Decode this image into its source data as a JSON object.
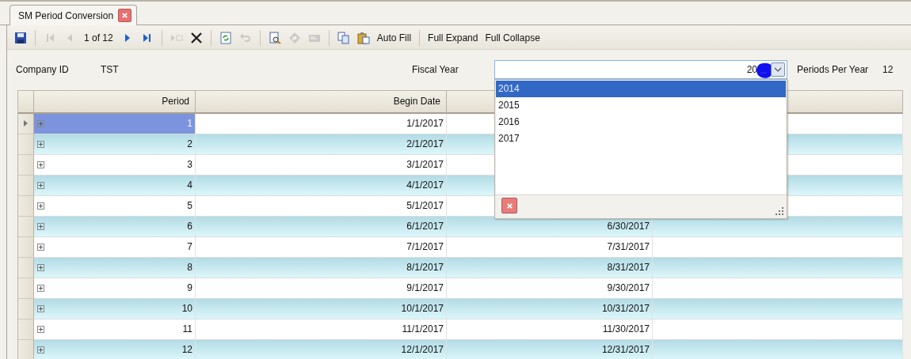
{
  "tabs": [
    {
      "title": "SM Period Conversion",
      "selected": true
    }
  ],
  "toolbar": {
    "groups": [
      [
        {
          "kind": "save",
          "disabled": false
        }
      ],
      [
        {
          "kind": "first",
          "disabled": true
        },
        {
          "kind": "prev",
          "disabled": true
        },
        {
          "kind": "counter",
          "text": "1 of 12"
        },
        {
          "kind": "next",
          "disabled": false
        },
        {
          "kind": "last",
          "disabled": false
        }
      ],
      [
        {
          "kind": "append",
          "disabled": true
        },
        {
          "kind": "delete",
          "disabled": false
        }
      ],
      [
        {
          "kind": "refresh",
          "disabled": false
        },
        {
          "kind": "undo",
          "disabled": true
        }
      ],
      [
        {
          "kind": "preview",
          "disabled": false
        },
        {
          "kind": "forward",
          "disabled": true
        },
        {
          "kind": "mail",
          "disabled": true
        }
      ],
      [
        {
          "kind": "copy",
          "disabled": false
        },
        {
          "kind": "paste",
          "disabled": false
        },
        {
          "kind": "text",
          "text": "Auto Fill"
        }
      ],
      [
        {
          "kind": "text",
          "text": "Full Expand"
        },
        {
          "kind": "text",
          "text": "Full Collapse"
        }
      ]
    ]
  },
  "form": {
    "company_label": "Company ID",
    "company_value": "TST",
    "fiscal_year_label": "Fiscal Year",
    "fiscal_year_value": "20",
    "periods_label": "Periods Per Year",
    "periods_value": "12"
  },
  "fiscal_year_dropdown": {
    "expanded": true,
    "options": [
      {
        "label": "2014",
        "selected": true
      },
      {
        "label": "2015",
        "selected": false
      },
      {
        "label": "2016",
        "selected": false
      },
      {
        "label": "2017",
        "selected": false
      }
    ]
  },
  "table": {
    "columns": [
      "Period",
      "Begin Date"
    ],
    "rows": [
      {
        "period": "1",
        "begin_date": "1/1/2017",
        "selected": true,
        "expanded": false
      },
      {
        "period": "2",
        "begin_date": "2/1/2017",
        "selected": false,
        "expanded": false
      },
      {
        "period": "3",
        "begin_date": "3/1/2017",
        "selected": false,
        "expanded": false
      },
      {
        "period": "4",
        "begin_date": "4/1/2017",
        "selected": false,
        "expanded": false
      },
      {
        "period": "5",
        "begin_date": "5/1/2017",
        "selected": false,
        "expanded": false
      },
      {
        "period": "6",
        "begin_date": "6/1/2017",
        "end_date": "6/30/2017",
        "selected": false,
        "expanded": false
      },
      {
        "period": "7",
        "begin_date": "7/1/2017",
        "end_date": "7/31/2017",
        "selected": false,
        "expanded": false
      },
      {
        "period": "8",
        "begin_date": "8/1/2017",
        "end_date": "8/31/2017",
        "selected": false,
        "expanded": false
      },
      {
        "period": "9",
        "begin_date": "9/1/2017",
        "end_date": "9/30/2017",
        "selected": false,
        "expanded": false
      },
      {
        "period": "10",
        "begin_date": "10/1/2017",
        "end_date": "10/31/2017",
        "selected": false,
        "expanded": false
      },
      {
        "period": "11",
        "begin_date": "11/1/2017",
        "end_date": "11/30/2017",
        "selected": false,
        "expanded": false
      },
      {
        "period": "12",
        "begin_date": "12/1/2017",
        "end_date": "12/31/2017",
        "selected": false,
        "expanded": false
      }
    ]
  }
}
